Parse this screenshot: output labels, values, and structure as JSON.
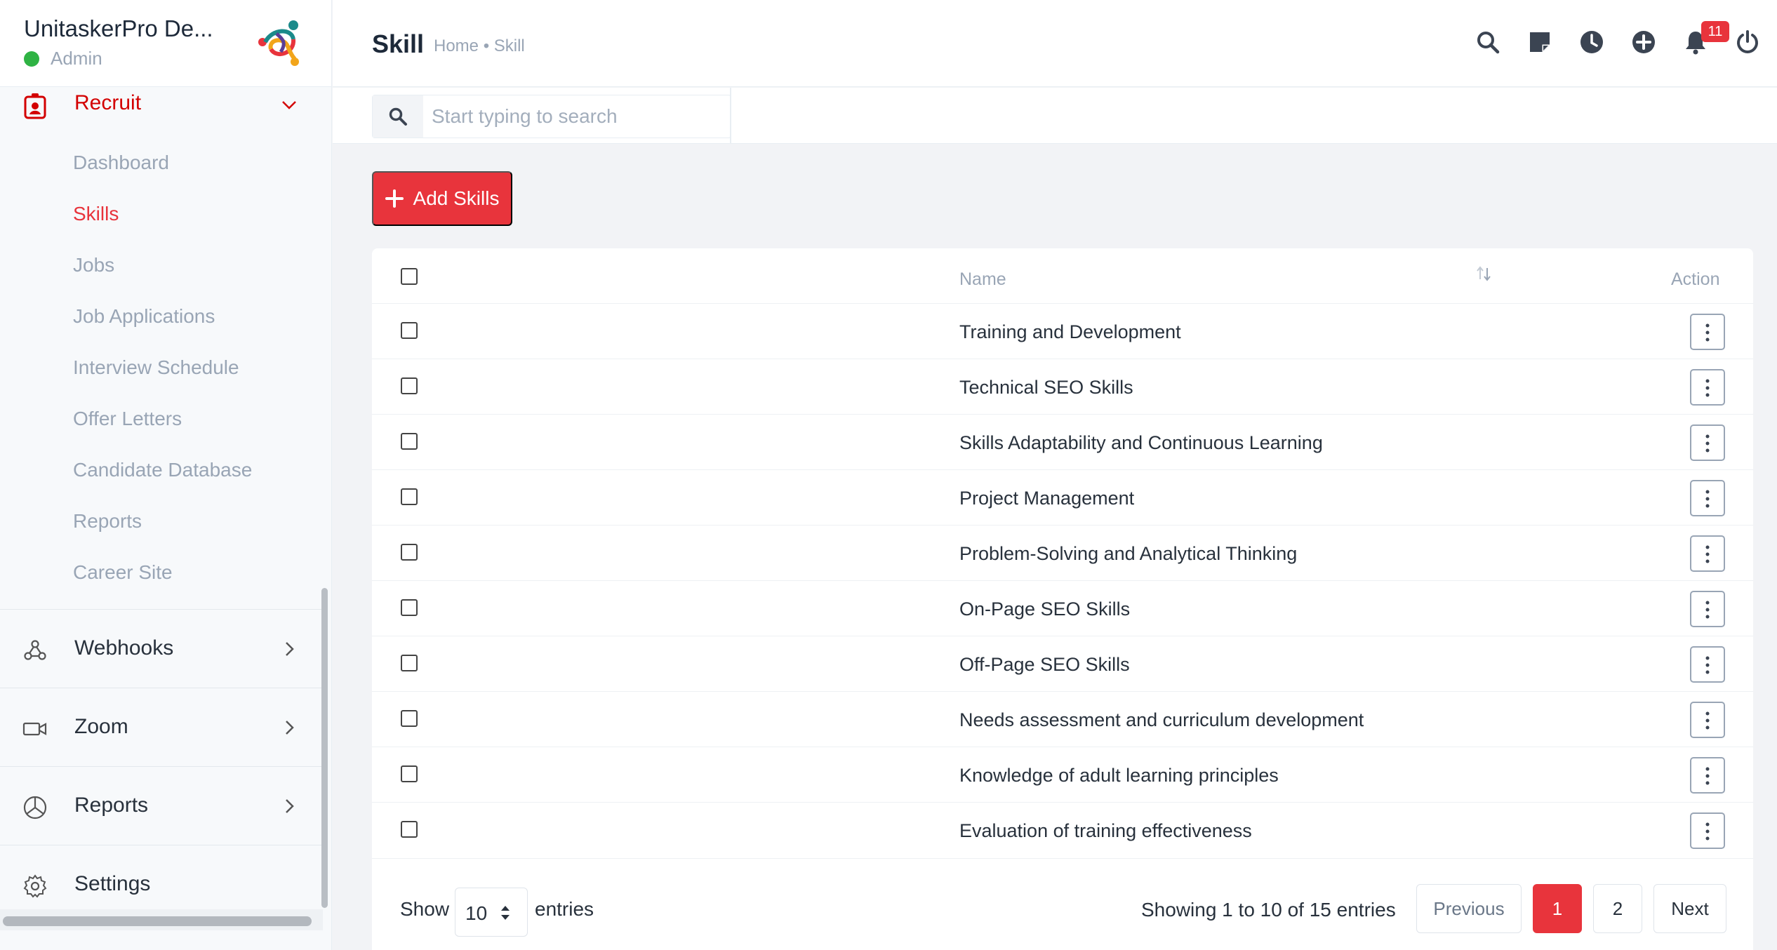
{
  "app": {
    "name": "UnitaskerPro De...",
    "role": "Admin"
  },
  "sidebar": {
    "recruit_label": "Recruit",
    "submenu": [
      {
        "label": "Dashboard",
        "active": false
      },
      {
        "label": "Skills",
        "active": true
      },
      {
        "label": "Jobs",
        "active": false
      },
      {
        "label": "Job Applications",
        "active": false
      },
      {
        "label": "Interview Schedule",
        "active": false
      },
      {
        "label": "Offer Letters",
        "active": false
      },
      {
        "label": "Candidate Database",
        "active": false
      },
      {
        "label": "Reports",
        "active": false
      },
      {
        "label": "Career Site",
        "active": false
      }
    ],
    "main": [
      {
        "label": "Webhooks",
        "icon": "webhooks-icon"
      },
      {
        "label": "Zoom",
        "icon": "video-camera-icon"
      },
      {
        "label": "Reports",
        "icon": "pie-chart-icon"
      },
      {
        "label": "Settings",
        "icon": "gear-icon"
      }
    ]
  },
  "header": {
    "title": "Skill",
    "breadcrumb": "Home • Skill",
    "notification_count": "11",
    "icons": [
      "search-icon",
      "sticky-note-icon",
      "clock-icon",
      "plus-circle-icon",
      "bell-icon",
      "power-icon"
    ]
  },
  "search": {
    "placeholder": "Start typing to search"
  },
  "toolbar": {
    "add_label": "Add Skills"
  },
  "table": {
    "columns": {
      "name": "Name",
      "action": "Action"
    },
    "rows": [
      {
        "name": "Training and Development"
      },
      {
        "name": "Technical SEO Skills"
      },
      {
        "name": "Skills Adaptability and Continuous Learning"
      },
      {
        "name": "Project Management"
      },
      {
        "name": "Problem-Solving and Analytical Thinking"
      },
      {
        "name": "On-Page SEO Skills"
      },
      {
        "name": "Off-Page SEO Skills"
      },
      {
        "name": "Needs assessment and curriculum development"
      },
      {
        "name": "Knowledge of adult learning principles"
      },
      {
        "name": "Evaluation of training effectiveness"
      }
    ]
  },
  "pagination": {
    "show_label": "Show",
    "page_length": "10",
    "entries_label": "entries",
    "info": "Showing 1 to 10 of 15 entries",
    "previous": "Previous",
    "pages": [
      "1",
      "2"
    ],
    "current_page": "1",
    "next": "Next"
  },
  "colors": {
    "accent": "#e8343c",
    "active_text": "#d30000",
    "status_online": "#2fb344"
  }
}
